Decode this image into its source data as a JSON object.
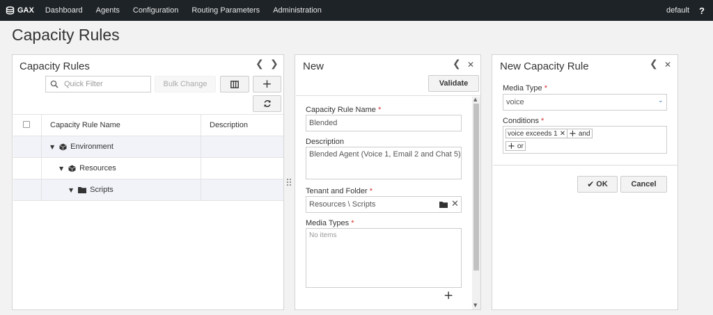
{
  "nav": {
    "brand": "GAX",
    "items": [
      "Dashboard",
      "Agents",
      "Configuration",
      "Routing Parameters",
      "Administration"
    ],
    "user": "default",
    "help": "?"
  },
  "page": {
    "title": "Capacity Rules"
  },
  "rules_panel": {
    "title": "Capacity Rules",
    "quick_filter_placeholder": "Quick Filter",
    "bulk_change": "Bulk Change",
    "columns": [
      "Capacity Rule Name",
      "Description"
    ],
    "rows": [
      {
        "name": "Environment",
        "icon": "cube-icon"
      },
      {
        "name": "Resources",
        "icon": "cube-icon"
      },
      {
        "name": "Scripts",
        "icon": "folder-icon"
      }
    ]
  },
  "new_panel": {
    "title": "New",
    "validate": "Validate",
    "name_label": "Capacity Rule Name",
    "name_value": "Blended",
    "desc_label": "Description",
    "desc_value": "Blended Agent (Voice 1, Email 2 and Chat 5)",
    "tenant_label": "Tenant and Folder",
    "tenant_value": "Resources \\ Scripts",
    "media_label": "Media Types",
    "media_empty": "No items"
  },
  "rule_panel": {
    "title": "New Capacity Rule",
    "media_type_label": "Media Type",
    "media_type_value": "voice",
    "conditions_label": "Conditions",
    "condition_chip": "voice exceeds 1",
    "and_label": "and",
    "or_label": "or",
    "ok": "OK",
    "cancel": "Cancel"
  },
  "colors": {
    "nav_bg": "#1e2327",
    "required": "#d32f2f",
    "row_alt": "#f1f3f9"
  }
}
